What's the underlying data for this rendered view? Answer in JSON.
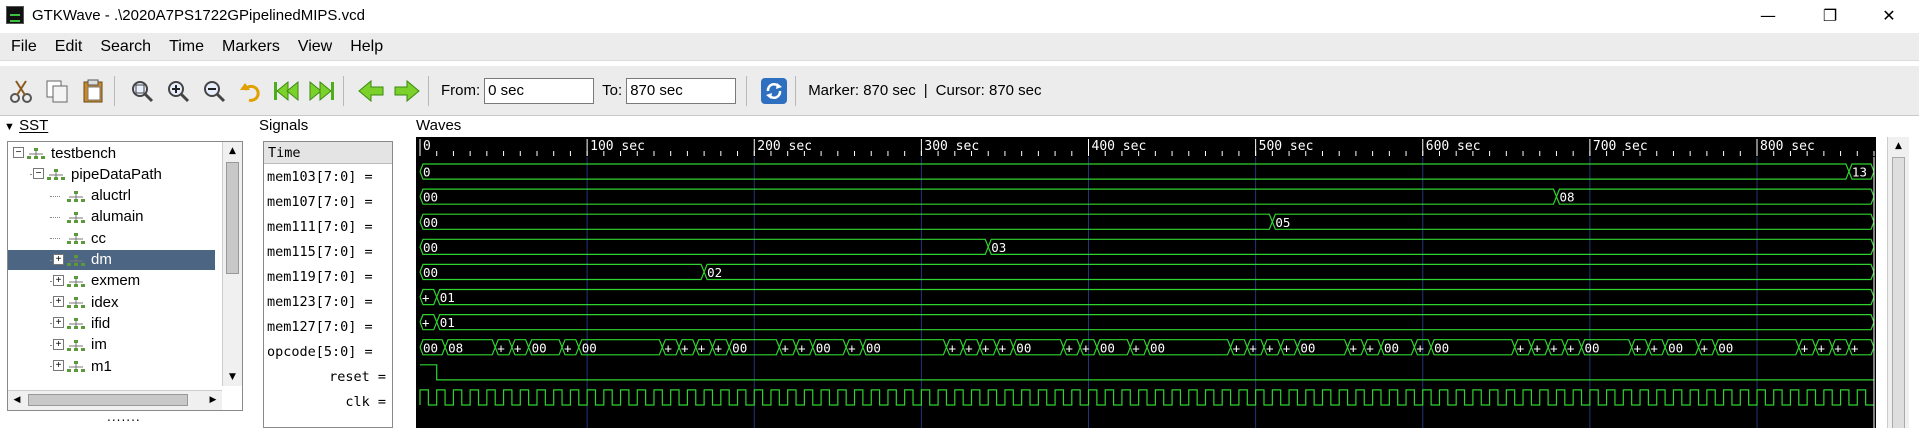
{
  "window": {
    "title": "GTKWave - .\\2020A7PS1722GPipelinedMIPS.vcd",
    "controls": {
      "minimize": "—",
      "maximize": "❐",
      "close": "✕"
    }
  },
  "menu": [
    "File",
    "Edit",
    "Search",
    "Time",
    "Markers",
    "View",
    "Help"
  ],
  "toolbar": {
    "from_label": "From:",
    "from_value": "0 sec",
    "to_label": "To:",
    "to_value": "870 sec",
    "marker_text": "Marker: 870 sec",
    "separator": "|",
    "cursor_text": "Cursor: 870 sec",
    "icons": [
      "cut-icon",
      "copy-icon",
      "paste-icon",
      "zoom-fit-icon",
      "zoom-in-icon",
      "zoom-out-icon",
      "undo-zoom-icon",
      "jump-start-icon",
      "jump-end-icon",
      "prev-edge-icon",
      "next-edge-icon",
      "reload-icon"
    ]
  },
  "sst": {
    "title": "SST",
    "tree": [
      {
        "label": "testbench",
        "level": 0,
        "expander": "minus"
      },
      {
        "label": "pipeDataPath",
        "level": 1,
        "expander": "minus"
      },
      {
        "label": "aluctrl",
        "level": 2,
        "expander": "none"
      },
      {
        "label": "alumain",
        "level": 2,
        "expander": "none"
      },
      {
        "label": "cc",
        "level": 2,
        "expander": "none"
      },
      {
        "label": "dm",
        "level": 2,
        "expander": "plus",
        "selected": true
      },
      {
        "label": "exmem",
        "level": 2,
        "expander": "plus"
      },
      {
        "label": "idex",
        "level": 2,
        "expander": "plus"
      },
      {
        "label": "ifid",
        "level": 2,
        "expander": "plus"
      },
      {
        "label": "im",
        "level": 2,
        "expander": "plus"
      },
      {
        "label": "m1",
        "level": 2,
        "expander": "plus"
      }
    ],
    "grip": "......."
  },
  "signals": {
    "title": "Signals",
    "header": "Time",
    "rows": [
      "mem103[7:0] =",
      "mem107[7:0] =",
      "mem111[7:0] =",
      "mem115[7:0] =",
      "mem119[7:0] =",
      "mem123[7:0] =",
      "mem127[7:0] =",
      "opcode[5:0] =",
      "reset =",
      "clk ="
    ]
  },
  "waves": {
    "title": "Waves",
    "time_end": 870,
    "ticks": [
      {
        "t": 0,
        "label": "0"
      },
      {
        "t": 100,
        "label": "100 sec"
      },
      {
        "t": 200,
        "label": "200 sec"
      },
      {
        "t": 300,
        "label": "300 sec"
      },
      {
        "t": 400,
        "label": "400 sec"
      },
      {
        "t": 500,
        "label": "500 sec"
      },
      {
        "t": 600,
        "label": "600 sec"
      },
      {
        "t": 700,
        "label": "700 sec"
      },
      {
        "t": 800,
        "label": "800 sec"
      }
    ],
    "colors": {
      "background": "#000000",
      "wave": "#2fd32f",
      "grid": "#22357a",
      "text": "#ffffff",
      "ruler": "#ffffff"
    },
    "traces": [
      {
        "type": "bus",
        "segments": [
          {
            "t": 0,
            "v": "0"
          },
          {
            "t": 855,
            "v": "13"
          }
        ]
      },
      {
        "type": "bus",
        "segments": [
          {
            "t": 0,
            "v": "00"
          },
          {
            "t": 680,
            "v": "08"
          }
        ]
      },
      {
        "type": "bus",
        "segments": [
          {
            "t": 0,
            "v": "00"
          },
          {
            "t": 510,
            "v": "05"
          }
        ]
      },
      {
        "type": "bus",
        "segments": [
          {
            "t": 0,
            "v": "00"
          },
          {
            "t": 340,
            "v": "03"
          }
        ]
      },
      {
        "type": "bus",
        "segments": [
          {
            "t": 0,
            "v": "00"
          },
          {
            "t": 170,
            "v": "02"
          }
        ]
      },
      {
        "type": "bus",
        "segments": [
          {
            "t": 0,
            "v": "+"
          },
          {
            "t": 10,
            "v": "01"
          }
        ]
      },
      {
        "type": "bus",
        "segments": [
          {
            "t": 0,
            "v": "+"
          },
          {
            "t": 10,
            "v": "01"
          }
        ]
      },
      {
        "type": "bus",
        "segments": [
          {
            "t": 0,
            "v": "00"
          },
          {
            "t": 15,
            "v": "08"
          },
          {
            "t": 45,
            "v": "+"
          },
          {
            "t": 55,
            "v": "+"
          },
          {
            "t": 65,
            "v": "00"
          },
          {
            "t": 85,
            "v": "+"
          },
          {
            "t": 95,
            "v": "00"
          },
          {
            "t": 145,
            "v": "+"
          },
          {
            "t": 155,
            "v": "+"
          },
          {
            "t": 165,
            "v": "+"
          },
          {
            "t": 175,
            "v": "+"
          },
          {
            "t": 185,
            "v": "00"
          },
          {
            "t": 215,
            "v": "+"
          },
          {
            "t": 225,
            "v": "+"
          },
          {
            "t": 235,
            "v": "00"
          },
          {
            "t": 255,
            "v": "+"
          },
          {
            "t": 265,
            "v": "00"
          },
          {
            "t": 315,
            "v": "+"
          },
          {
            "t": 325,
            "v": "+"
          },
          {
            "t": 335,
            "v": "+"
          },
          {
            "t": 345,
            "v": "+"
          },
          {
            "t": 355,
            "v": "00"
          },
          {
            "t": 385,
            "v": "+"
          },
          {
            "t": 395,
            "v": "+"
          },
          {
            "t": 405,
            "v": "00"
          },
          {
            "t": 425,
            "v": "+"
          },
          {
            "t": 435,
            "v": "00"
          },
          {
            "t": 485,
            "v": "+"
          },
          {
            "t": 495,
            "v": "+"
          },
          {
            "t": 505,
            "v": "+"
          },
          {
            "t": 515,
            "v": "+"
          },
          {
            "t": 525,
            "v": "00"
          },
          {
            "t": 555,
            "v": "+"
          },
          {
            "t": 565,
            "v": "+"
          },
          {
            "t": 575,
            "v": "00"
          },
          {
            "t": 595,
            "v": "+"
          },
          {
            "t": 605,
            "v": "00"
          },
          {
            "t": 655,
            "v": "+"
          },
          {
            "t": 665,
            "v": "+"
          },
          {
            "t": 675,
            "v": "+"
          },
          {
            "t": 685,
            "v": "+"
          },
          {
            "t": 695,
            "v": "00"
          },
          {
            "t": 725,
            "v": "+"
          },
          {
            "t": 735,
            "v": "+"
          },
          {
            "t": 745,
            "v": "00"
          },
          {
            "t": 765,
            "v": "+"
          },
          {
            "t": 775,
            "v": "00"
          },
          {
            "t": 825,
            "v": "+"
          },
          {
            "t": 835,
            "v": "+"
          },
          {
            "t": 845,
            "v": "+"
          },
          {
            "t": 855,
            "v": "+"
          }
        ]
      },
      {
        "type": "bit",
        "transitions": [
          {
            "t": 0,
            "v": 1
          },
          {
            "t": 10,
            "v": 0
          }
        ]
      },
      {
        "type": "clock",
        "half_period": 5,
        "start": 0
      }
    ]
  }
}
